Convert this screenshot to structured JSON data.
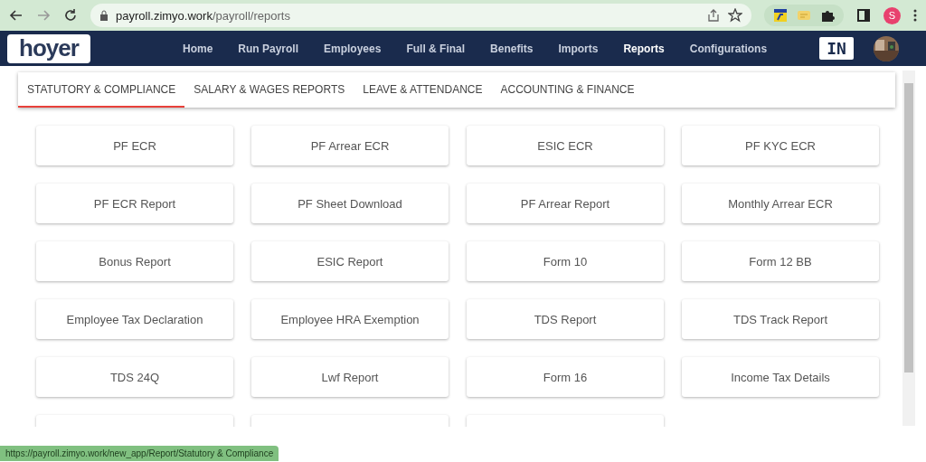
{
  "browser": {
    "url_host": "payroll.zimyo.work",
    "url_path": "/payroll/reports",
    "profile_initial": "S"
  },
  "header": {
    "logo": "hoyer",
    "nav": [
      {
        "label": "Home",
        "selected": false
      },
      {
        "label": "Run Payroll",
        "selected": false
      },
      {
        "label": "Employees",
        "selected": false
      },
      {
        "label": "Full & Final",
        "selected": false
      },
      {
        "label": "Benefits",
        "selected": false
      },
      {
        "label": "Imports",
        "selected": false
      },
      {
        "label": "Reports",
        "selected": true
      },
      {
        "label": "Configurations",
        "selected": false
      }
    ],
    "country": "IN"
  },
  "tabs": [
    {
      "label": "STATUTORY & COMPLIANCE",
      "selected": true
    },
    {
      "label": "SALARY & WAGES REPORTS",
      "selected": false
    },
    {
      "label": "LEAVE & ATTENDANCE",
      "selected": false
    },
    {
      "label": "ACCOUNTING & FINANCE",
      "selected": false
    }
  ],
  "reports": [
    {
      "kind": "report",
      "label": "PF ECR"
    },
    {
      "kind": "report",
      "label": "PF Arrear ECR"
    },
    {
      "kind": "report",
      "label": "ESIC ECR"
    },
    {
      "kind": "report",
      "label": "PF KYC ECR"
    },
    {
      "kind": "report",
      "label": "PF ECR Report"
    },
    {
      "kind": "report",
      "label": "PF Sheet Download"
    },
    {
      "kind": "report",
      "label": "PF Arrear Report"
    },
    {
      "kind": "report",
      "label": "Monthly Arrear ECR"
    },
    {
      "kind": "report",
      "label": "Bonus Report"
    },
    {
      "kind": "report",
      "label": "ESIC Report"
    },
    {
      "kind": "report",
      "label": "Form 10"
    },
    {
      "kind": "report",
      "label": "Form 12 BB"
    },
    {
      "kind": "report",
      "label": "Employee Tax Declaration"
    },
    {
      "kind": "report",
      "label": "Employee HRA Exemption"
    },
    {
      "kind": "report",
      "label": "TDS Report"
    },
    {
      "kind": "report",
      "label": "TDS Track Report"
    },
    {
      "kind": "report",
      "label": "TDS 24Q"
    },
    {
      "kind": "report",
      "label": "Lwf Report"
    },
    {
      "kind": "report",
      "label": "Form 16"
    },
    {
      "kind": "report",
      "label": "Income Tax Details"
    },
    {
      "kind": "hidden"
    },
    {
      "kind": "hidden"
    },
    {
      "kind": "hidden"
    }
  ],
  "status_url": "https://payroll.zimyo.work/new_app/Report/Statutory & Compliance"
}
